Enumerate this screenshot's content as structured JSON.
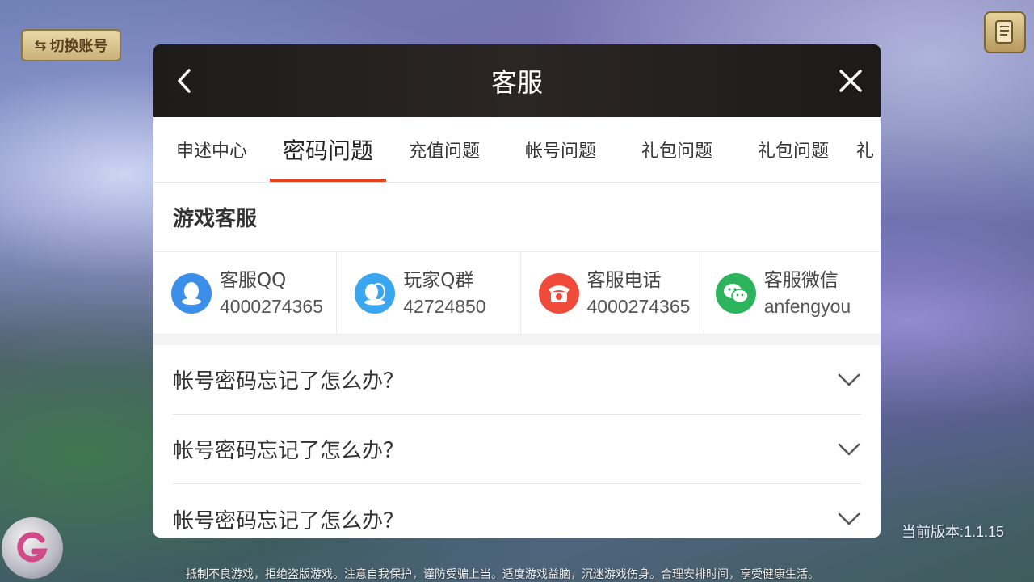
{
  "top_left": {
    "switch_account_label": "切换账号"
  },
  "dialog": {
    "title": "客服",
    "tabs": [
      {
        "label": "申述中心",
        "active": false
      },
      {
        "label": "密码问题",
        "active": true
      },
      {
        "label": "充值问题",
        "active": false
      },
      {
        "label": "帐号问题",
        "active": false
      },
      {
        "label": "礼包问题",
        "active": false
      },
      {
        "label": "礼包问题",
        "active": false
      },
      {
        "label": "礼",
        "active": false
      }
    ],
    "section_title": "游戏客服",
    "contacts": [
      {
        "name": "客服QQ",
        "value": "4000274365",
        "icon": "qq-icon",
        "color": "#3b8fe8"
      },
      {
        "name": "玩家Q群",
        "value": "42724850",
        "icon": "qq-group-icon",
        "color": "#3aa6f0"
      },
      {
        "name": "客服电话",
        "value": "4000274365",
        "icon": "phone-icon",
        "color": "#f04b3a"
      },
      {
        "name": "客服微信",
        "value": "anfengyou",
        "icon": "wechat-icon",
        "color": "#2bb45c"
      }
    ],
    "faq": [
      {
        "question": "帐号密码忘记了怎么办？"
      },
      {
        "question": "帐号密码忘记了怎么办？"
      },
      {
        "question": "帐号密码忘记了怎么办？"
      }
    ]
  },
  "version": "当前版本:1.1.15",
  "footer_note": "抵制不良游戏，拒绝盗版游戏。注意自我保护，谨防受骗上当。适度游戏益脑，沉迷游戏伤身。合理安排时间，享受健康生活。"
}
